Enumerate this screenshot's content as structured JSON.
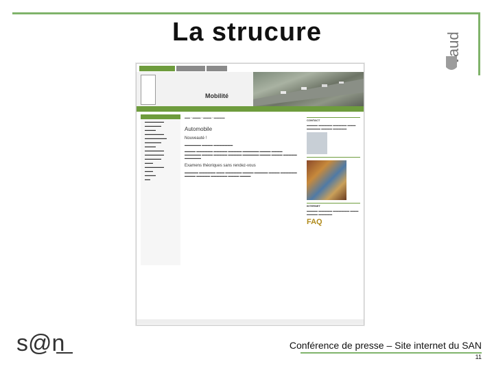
{
  "slide": {
    "title": "La strucure",
    "footer_text": "Conférence de presse – Site internet du SAN",
    "page_number": "11",
    "accent_color": "#7fb36a",
    "logo_right": "vaud",
    "logo_left": "s@n"
  },
  "embedded_site": {
    "page_title": "Mobilité",
    "heading": "Automobile",
    "subheading": "Nouveauté !",
    "section_heading": "Examens théoriques sans rendez-vous",
    "contact_heading": "CONTACT",
    "info_heading": "INTERNET",
    "faq": "FAQ"
  }
}
